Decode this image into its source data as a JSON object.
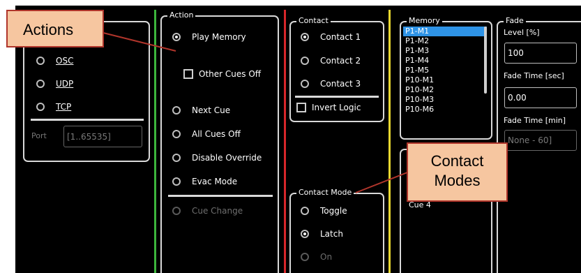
{
  "protocol": {
    "options": [
      {
        "label": "OSC",
        "selected": false
      },
      {
        "label": "UDP",
        "selected": false
      },
      {
        "label": "TCP",
        "selected": false
      }
    ],
    "port_label": "Port",
    "port_placeholder": "[1..65535]"
  },
  "action": {
    "title": "Action",
    "play_memory": "Play Memory",
    "other_cues_off": "Other Cues Off",
    "next_cue": "Next Cue",
    "all_cues_off": "All Cues Off",
    "disable_override": "Disable Override",
    "evac_mode": "Evac Mode",
    "cue_change": "Cue Change"
  },
  "contact": {
    "title": "Contact",
    "options": [
      "Contact 1",
      "Contact 2",
      "Contact 3"
    ],
    "invert_logic": "Invert Logic"
  },
  "contact_mode": {
    "title": "Contact Mode",
    "toggle": "Toggle",
    "latch": "Latch",
    "on": "On"
  },
  "memory": {
    "title": "Memory",
    "items": [
      "P1-M1",
      "P1-M2",
      "P1-M3",
      "P1-M4",
      "P1-M5",
      "P10-M1",
      "P10-M2",
      "P10-M3",
      "P10-M6"
    ],
    "selected": "P1-M1",
    "cue_partial": "Cue 4"
  },
  "fade": {
    "title": "Fade",
    "level_label": "Level [%]",
    "level_value": "100",
    "fade_time_sec_label": "Fade Time [sec]",
    "fade_time_sec_value": "0.00",
    "fade_time_min_label": "Fade Time [min]",
    "fade_time_min_placeholder": "None - 60]"
  },
  "callouts": {
    "actions": "Actions",
    "contact_modes_line1": "Contact",
    "contact_modes_line2": "Modes"
  },
  "colors": {
    "green_divider": "#3cb53c",
    "red_divider": "#d8262a",
    "yellow_divider": "#e9d82f",
    "selection": "#2e93e6",
    "callout_fill": "#f6c6a0",
    "callout_border": "#b0352b"
  }
}
